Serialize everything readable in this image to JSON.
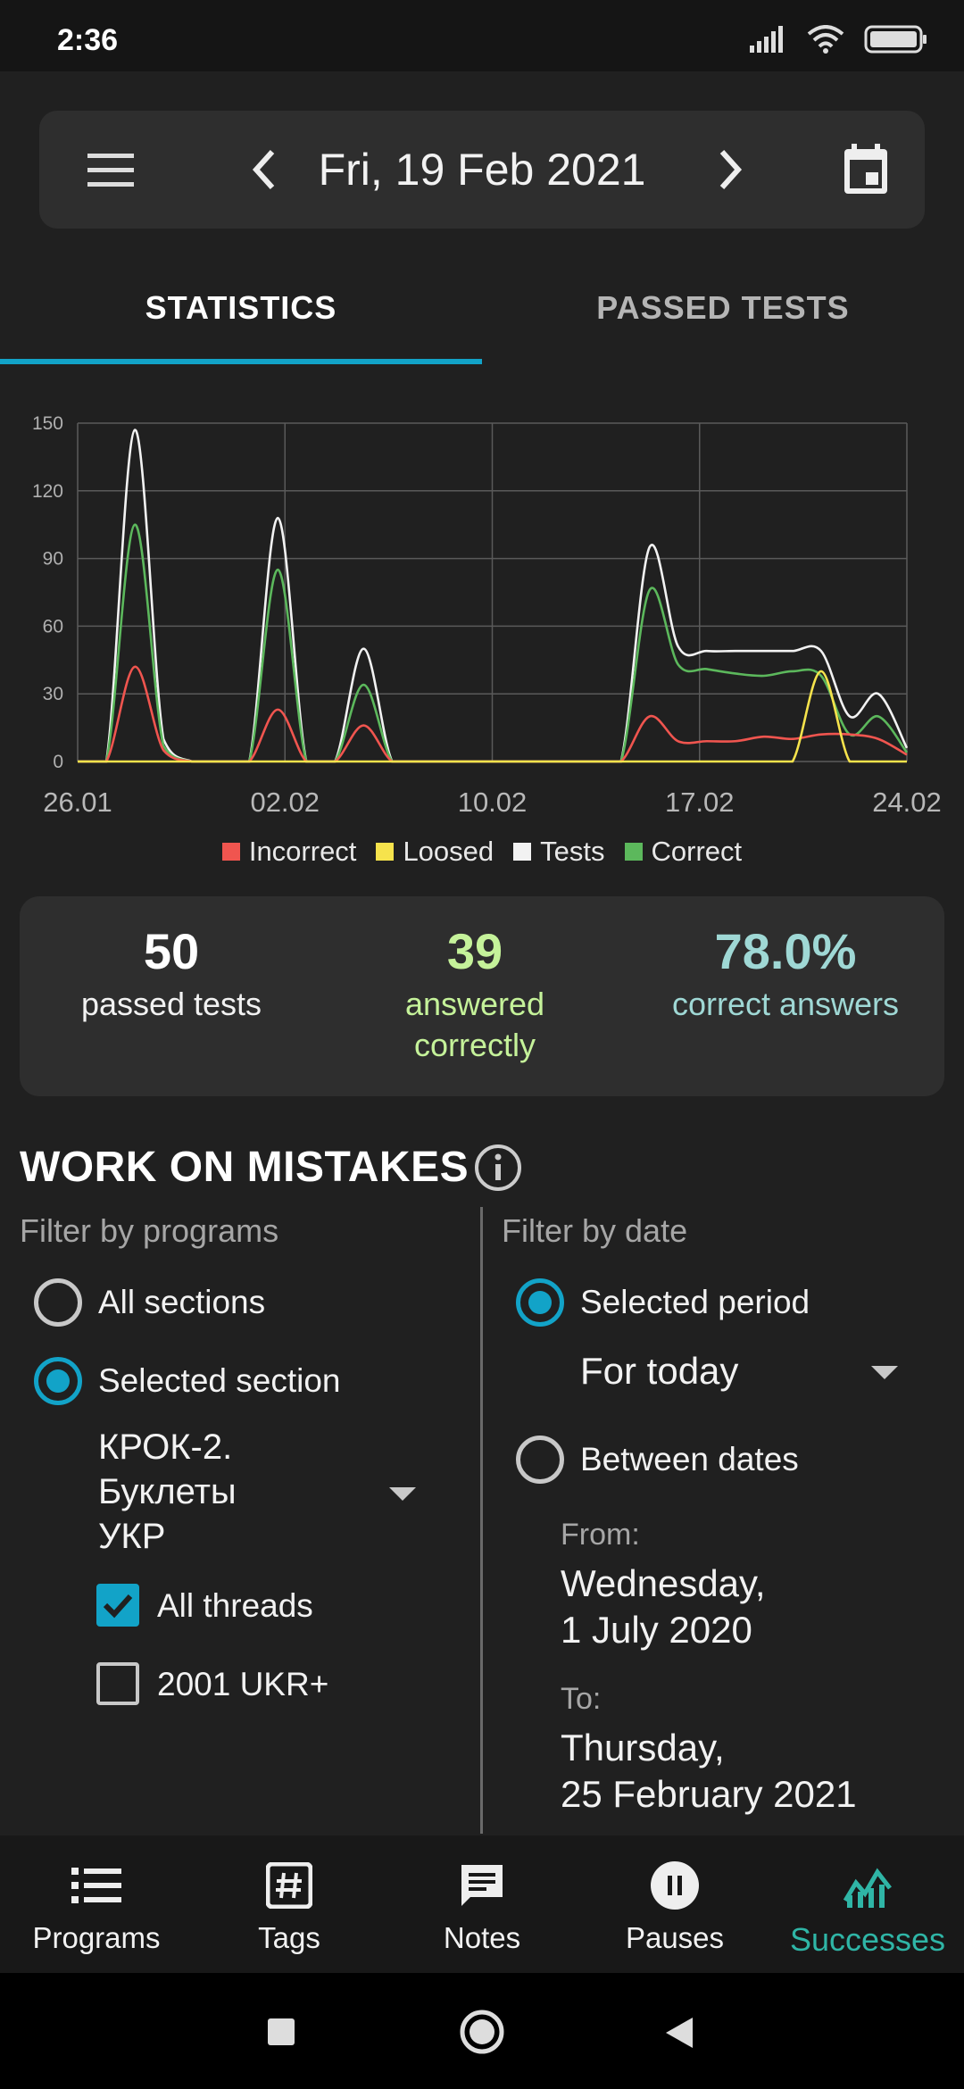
{
  "status_bar": {
    "time": "2:36"
  },
  "app_bar": {
    "date": "Fri, 19 Feb 2021"
  },
  "tabs": [
    {
      "label": "STATISTICS",
      "active": true
    },
    {
      "label": "PASSED TESTS",
      "active": false
    }
  ],
  "chart_data": {
    "type": "line",
    "title": "",
    "xlabel": "",
    "ylabel": "",
    "x_tick_labels": [
      "26.01",
      "02.02",
      "10.02",
      "17.02",
      "24.02"
    ],
    "y_tick_labels": [
      "0",
      "30",
      "60",
      "90",
      "120",
      "150"
    ],
    "ylim": [
      0,
      150
    ],
    "grid": true,
    "legend_position": "bottom",
    "x_days": [
      0,
      1,
      2,
      3,
      4,
      5,
      6,
      7,
      8,
      9,
      10,
      11,
      12,
      13,
      14,
      15,
      16,
      17,
      18,
      19,
      20,
      21,
      22,
      23,
      24,
      25,
      26,
      27,
      28,
      29
    ],
    "series": [
      {
        "name": "Incorrect",
        "color": "#f0554f",
        "values": [
          0,
          0,
          42,
          5,
          0,
          0,
          0,
          23,
          0,
          0,
          16,
          0,
          0,
          0,
          0,
          0,
          0,
          0,
          0,
          0,
          20,
          9,
          9,
          9,
          11,
          10,
          12,
          12,
          10,
          3
        ]
      },
      {
        "name": "Loosed",
        "color": "#f6e34c",
        "values": [
          0,
          0,
          0,
          0,
          0,
          0,
          0,
          0,
          0,
          0,
          0,
          0,
          0,
          0,
          0,
          0,
          0,
          0,
          0,
          0,
          0,
          0,
          0,
          0,
          0,
          0,
          40,
          0,
          0,
          0
        ]
      },
      {
        "name": "Tests",
        "color": "#f2f2f2",
        "values": [
          0,
          0,
          147,
          10,
          0,
          0,
          0,
          108,
          0,
          0,
          50,
          0,
          0,
          0,
          0,
          0,
          0,
          0,
          0,
          0,
          95,
          51,
          49,
          49,
          49,
          49,
          49,
          20,
          30,
          6
        ]
      },
      {
        "name": "Correct",
        "color": "#5cb85c",
        "values": [
          0,
          0,
          105,
          7,
          0,
          0,
          0,
          85,
          0,
          0,
          34,
          0,
          0,
          0,
          0,
          0,
          0,
          0,
          0,
          0,
          76,
          43,
          41,
          39,
          38,
          40,
          38,
          12,
          20,
          4
        ]
      }
    ]
  },
  "summary": {
    "passed": {
      "value": "50",
      "label": "passed tests",
      "color": "#ffffff"
    },
    "answered": {
      "value": "39",
      "label": "answered\ncorrectly",
      "color": "#c5f29a"
    },
    "correct": {
      "value": "78.0%",
      "label": "correct answers",
      "color": "#9fd8d5"
    }
  },
  "mistakes": {
    "title": "WORK ON MISTAKES",
    "programs_filter_label": "Filter by programs",
    "all_sections": "All sections",
    "selected_section": "Selected section",
    "program_value": "КРОК-2.\nБуклеты\nУКР",
    "all_threads": "All threads",
    "thread_item": "2001 UKR+",
    "date_filter_label": "Filter by date",
    "selected_period": "Selected period",
    "period_value": "For today",
    "between_dates": "Between dates",
    "from_label": "From:",
    "from_value": "Wednesday,\n1 July 2020",
    "to_label": "To:",
    "to_value": "Thursday,\n25 February 2021"
  },
  "bottom_nav": [
    {
      "label": "Programs",
      "icon": "list-icon"
    },
    {
      "label": "Tags",
      "icon": "hash-icon"
    },
    {
      "label": "Notes",
      "icon": "note-icon"
    },
    {
      "label": "Pauses",
      "icon": "pause-icon"
    },
    {
      "label": "Successes",
      "icon": "chart-icon",
      "active": true
    }
  ],
  "accent_color": "#12a3c8"
}
